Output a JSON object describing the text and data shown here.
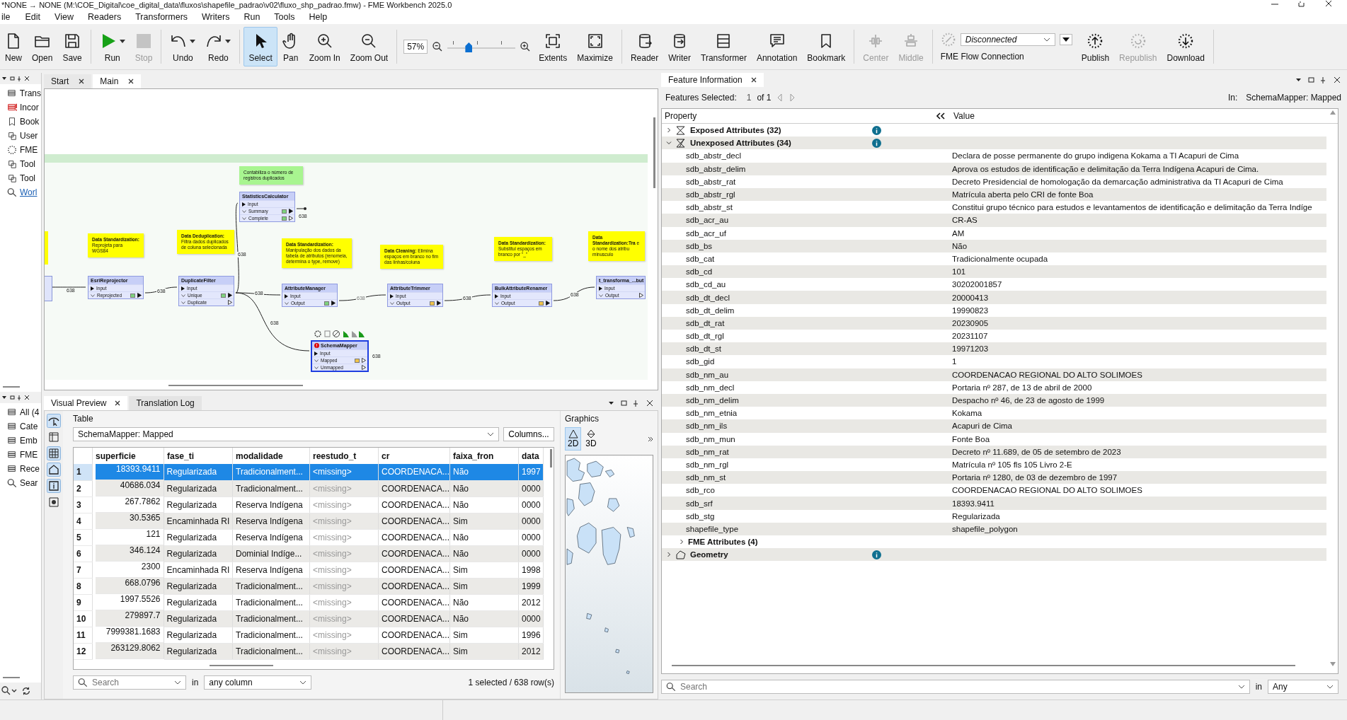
{
  "window": {
    "title": "*NONE → NONE (M:\\COE_Digital\\coe_digital_data\\fluxos\\shapefile_padrao\\v02\\fluxo_shp_padrao.fmw) - FME Workbench 2025.0"
  },
  "menu": [
    "ile",
    "Edit",
    "View",
    "Readers",
    "Transformers",
    "Writers",
    "Run",
    "Tools",
    "Help"
  ],
  "toolbar": [
    {
      "kind": "button",
      "label": "New",
      "disabled": false,
      "selected": false
    },
    {
      "kind": "button",
      "label": "Open",
      "disabled": false,
      "selected": false
    },
    {
      "kind": "button",
      "label": "Save",
      "disabled": false,
      "selected": false
    },
    {
      "kind": "split",
      "label": "Run",
      "disabled": false,
      "selected": false
    },
    {
      "kind": "button",
      "label": "Stop",
      "disabled": true,
      "selected": false
    },
    {
      "kind": "split",
      "label": "Undo",
      "disabled": false,
      "selected": false
    },
    {
      "kind": "split",
      "label": "Redo",
      "disabled": false,
      "selected": false
    },
    {
      "kind": "button",
      "label": "Select",
      "disabled": false,
      "selected": true
    },
    {
      "kind": "button",
      "label": "Pan",
      "disabled": false,
      "selected": false
    },
    {
      "kind": "button",
      "label": "Zoom In",
      "disabled": false,
      "selected": false
    },
    {
      "kind": "button",
      "label": "Zoom Out",
      "disabled": false,
      "selected": false
    },
    {
      "kind": "zoom",
      "value": "57%",
      "level": 0.3
    },
    {
      "kind": "button",
      "label": "Extents",
      "disabled": false,
      "selected": false
    },
    {
      "kind": "button",
      "label": "Maximize",
      "disabled": false,
      "selected": false
    },
    {
      "kind": "button",
      "label": "Reader",
      "disabled": false,
      "selected": false
    },
    {
      "kind": "button",
      "label": "Writer",
      "disabled": false,
      "selected": false
    },
    {
      "kind": "button",
      "label": "Transformer",
      "disabled": false,
      "selected": false
    },
    {
      "kind": "button",
      "label": "Annotation",
      "disabled": false,
      "selected": false
    },
    {
      "kind": "button",
      "label": "Bookmark",
      "disabled": false,
      "selected": false
    },
    {
      "kind": "button",
      "label": "Center",
      "disabled": true,
      "selected": false
    },
    {
      "kind": "button",
      "label": "Middle",
      "disabled": true,
      "selected": false
    },
    {
      "kind": "connection",
      "value": "Disconnected",
      "label": "FME Flow Connection"
    },
    {
      "kind": "button",
      "label": "Publish",
      "disabled": false,
      "selected": false
    },
    {
      "kind": "button",
      "label": "Republish",
      "disabled": true,
      "selected": false
    },
    {
      "kind": "button",
      "label": "Download",
      "disabled": false,
      "selected": false
    }
  ],
  "left_dock_top": [
    {
      "label": "Trans",
      "kind": "item"
    },
    {
      "label": "Incor",
      "kind": "item"
    },
    {
      "label": "Book",
      "kind": "item"
    },
    {
      "label": "User",
      "kind": "item"
    },
    {
      "label": "FME",
      "kind": "item"
    },
    {
      "label": "Tool",
      "kind": "item"
    },
    {
      "label": "Tool",
      "kind": "item"
    },
    {
      "label": "Worl",
      "kind": "link"
    }
  ],
  "left_dock_bottom": [
    {
      "label": "All (4"
    },
    {
      "label": "Cate"
    },
    {
      "label": "Emb"
    },
    {
      "label": "FME"
    },
    {
      "label": "Rece"
    },
    {
      "label": "Sear"
    }
  ],
  "canvas_tabs": [
    {
      "label": "Start",
      "selected": false
    },
    {
      "label": "Main",
      "selected": true
    }
  ],
  "workflow": {
    "annotations": [
      {
        "text": "Contabiliza o número de registros duplicados",
        "color": "#a8f590"
      },
      {
        "text": "**Data Standardization:** Reprojeta para WGS84",
        "color": "#ffff00"
      },
      {
        "text": "**Data Deduplication:** Filtra dados duplicados de coluna selecionada",
        "color": "#ffff00"
      },
      {
        "text": "**Data Standardization:** Manipulação dos dados da tabela de atributos (renomeia, determina o type, remove)",
        "color": "#ffff00"
      },
      {
        "text": "**Data Cleaning:** Elimina espaços em branco no fim das linhas/coluna",
        "color": "#ffff00"
      },
      {
        "text": "**Data Standardization:** Substitui espaços em branco por \"_\"",
        "color": "#ffff00"
      },
      {
        "text": "**Data Standardization:Tra** e o nome dos atribu minusculo",
        "color": "#ffff00"
      }
    ],
    "transformers": [
      {
        "name": "EsriReprojector",
        "selected": false,
        "error": false,
        "inputs": [
          "Input"
        ],
        "outputs": [
          {
            "name": "Reprojected",
            "color": "#7ed37e",
            "connected": true
          }
        ]
      },
      {
        "name": "DuplicateFilter",
        "selected": false,
        "error": false,
        "inputs": [
          "Input"
        ],
        "outputs": [
          {
            "name": "Unique",
            "color": "#7ed37e",
            "connected": true
          },
          {
            "name": "Duplicate",
            "connected": false
          }
        ]
      },
      {
        "name": "StatisticsCalculator",
        "selected": false,
        "error": false,
        "inputs": [
          "Input"
        ],
        "outputs": [
          {
            "name": "Summary",
            "color": "#7ed37e",
            "connected": true
          },
          {
            "name": "Complete",
            "color": "#7ed37e",
            "connected": false
          }
        ]
      },
      {
        "name": "AttributeManager",
        "selected": false,
        "error": false,
        "inputs": [
          "Input"
        ],
        "outputs": [
          {
            "name": "Output",
            "color": "#7ed37e",
            "connected": true
          }
        ]
      },
      {
        "name": "AttributeTrimmer",
        "selected": false,
        "error": false,
        "inputs": [
          "Input"
        ],
        "outputs": [
          {
            "name": "Output",
            "color": "#f0c44a",
            "connected": true
          }
        ]
      },
      {
        "name": "BulkAttributeRenamer",
        "selected": false,
        "error": false,
        "inputs": [
          "Input"
        ],
        "outputs": [
          {
            "name": "Output",
            "color": "#f0c44a",
            "connected": true
          }
        ]
      },
      {
        "name": "t_transforma_...but",
        "selected": false,
        "error": false,
        "inputs": [
          "Input"
        ],
        "outputs": [
          {
            "name": "Output",
            "connected": false
          }
        ]
      },
      {
        "name": "SchemaMapper",
        "selected": true,
        "error": true,
        "inputs": [
          "Input"
        ],
        "outputs": [
          {
            "name": "Mapped",
            "color": "#f0c44a",
            "connected": false
          },
          {
            "name": "Unmapped",
            "connected": false
          }
        ]
      }
    ],
    "edges": [
      {
        "label": "638",
        "dimmed": false
      },
      {
        "label": "638",
        "dimmed": false
      },
      {
        "label": "638",
        "dimmed": false
      },
      {
        "label": "638",
        "dimmed": false
      },
      {
        "label": "638",
        "dimmed": false
      },
      {
        "label": "638",
        "dimmed": true
      },
      {
        "label": "638",
        "dimmed": false
      },
      {
        "label": "638",
        "dimmed": false
      },
      {
        "label": "638",
        "dimmed": false
      },
      {
        "label": "638",
        "dimmed": false
      }
    ]
  },
  "visual_preview": {
    "tabs": [
      {
        "label": "Visual Preview",
        "selected": true
      },
      {
        "label": "Translation Log",
        "selected": false
      }
    ],
    "tools": [
      {
        "selected": true
      },
      {
        "selected": false
      },
      {
        "selected": true
      },
      {
        "selected": true
      },
      {
        "selected": true
      },
      {
        "selected": false
      }
    ],
    "table_label": "Table",
    "source": "SchemaMapper: Mapped",
    "columns_button": "Columns...",
    "columns": [
      {
        "label": "superficie",
        "muted": false
      },
      {
        "label": "fase_ti",
        "muted": false
      },
      {
        "label": "modalidade",
        "muted": false
      },
      {
        "label": "reestudo_t",
        "muted": true
      },
      {
        "label": "cr",
        "muted": false
      },
      {
        "label": "faixa_fron",
        "muted": false
      },
      {
        "label": "data",
        "muted": false
      }
    ],
    "rows": [
      {
        "index": "1",
        "selected": true,
        "cells": [
          "18393.9411",
          "Regularizada",
          "Tradicionalment...",
          "<missing>",
          "COORDENACA...",
          "Não",
          "1997"
        ]
      },
      {
        "index": "2",
        "selected": false,
        "cells": [
          "40686.034",
          "Regularizada",
          "Tradicionalment...",
          "<missing>",
          "COORDENACA...",
          "Não",
          "0000"
        ]
      },
      {
        "index": "3",
        "selected": false,
        "cells": [
          "267.7862",
          "Regularizada",
          "Reserva Indígena",
          "<missing>",
          "COORDENACA...",
          "Não",
          "0000"
        ]
      },
      {
        "index": "4",
        "selected": false,
        "cells": [
          "30.5365",
          "Encaminhada RI",
          "Reserva Indígena",
          "<missing>",
          "COORDENACA...",
          "Sim",
          "0000"
        ]
      },
      {
        "index": "5",
        "selected": false,
        "cells": [
          "121",
          "Regularizada",
          "Reserva Indígena",
          "<missing>",
          "COORDENACA...",
          "Não",
          "0000"
        ]
      },
      {
        "index": "6",
        "selected": false,
        "cells": [
          "346.124",
          "Regularizada",
          "Dominial Indíge...",
          "<missing>",
          "COORDENACA...",
          "Não",
          "0000"
        ]
      },
      {
        "index": "7",
        "selected": false,
        "cells": [
          "2300",
          "Encaminhada RI",
          "Reserva Indígena",
          "<missing>",
          "COORDENACA...",
          "Sim",
          "1998"
        ]
      },
      {
        "index": "8",
        "selected": false,
        "cells": [
          "668.0796",
          "Regularizada",
          "Tradicionalment...",
          "<missing>",
          "COORDENACA...",
          "Sim",
          "1999"
        ]
      },
      {
        "index": "9",
        "selected": false,
        "cells": [
          "1997.5526",
          "Regularizada",
          "Tradicionalment...",
          "<missing>",
          "COORDENACA...",
          "Não",
          "2012"
        ]
      },
      {
        "index": "10",
        "selected": false,
        "cells": [
          "279897.7",
          "Regularizada",
          "Tradicionalment...",
          "<missing>",
          "COORDENACA...",
          "Não",
          "0000"
        ]
      },
      {
        "index": "11",
        "selected": false,
        "cells": [
          "7999381.1683",
          "Regularizada",
          "Tradicionalment...",
          "<missing>",
          "COORDENACA...",
          "Sim",
          "1996"
        ]
      },
      {
        "index": "12",
        "selected": false,
        "cells": [
          "263129.8062",
          "Regularizada",
          "Tradicionalment...",
          "<missing>",
          "COORDENACA...",
          "Sim",
          "2012"
        ]
      }
    ],
    "search_placeholder": "Search",
    "in_label": "in",
    "scope": "any column",
    "count": "1 selected / 638 row(s)",
    "graphics": {
      "title": "Graphics",
      "modes": [
        {
          "label": "2D",
          "selected": true
        },
        {
          "label": "3D",
          "selected": false
        }
      ]
    }
  },
  "feature_info": {
    "tab": "Feature Information",
    "selected_label": "Features Selected:",
    "current": "1",
    "of": "of 1",
    "source_label": "In:",
    "source": "SchemaMapper: Mapped",
    "columns": [
      "Property",
      "Value"
    ],
    "tree": [
      {
        "label": "Exposed Attributes (32)",
        "kind": "sigma",
        "expanded": false,
        "info": true
      },
      {
        "label": "Unexposed Attributes (34)",
        "kind": "sigma-off",
        "expanded": true,
        "info": true,
        "children": [
          {
            "name": "sdb_abstr_decl",
            "value": "Declara de posse permanente do grupo indigena Kokama a TI Acapuri de Cima"
          },
          {
            "name": "sdb_abstr_delim",
            "value": "Aprova os estudos de identificação e delimitação da Terra Indígena Acapuri de Cima."
          },
          {
            "name": "sdb_abstr_rat",
            "value": "Decreto Presidencial de homologação da demarcação administrativa da TI Acapuri de Cima"
          },
          {
            "name": "sdb_abstr_rgl",
            "value": "Matrícula aberta pelo CRI de fonte Boa"
          },
          {
            "name": "sdb_abstr_st",
            "value": "Constitui grupo técnico para estudos e levantamentos de identificação e delimitação da Terra Indíge"
          },
          {
            "name": "sdb_acr_au",
            "value": "CR-AS"
          },
          {
            "name": "sdb_acr_uf",
            "value": "AM"
          },
          {
            "name": "sdb_bs",
            "value": "Não"
          },
          {
            "name": "sdb_cat",
            "value": "Tradicionalmente ocupada"
          },
          {
            "name": "sdb_cd",
            "value": "101"
          },
          {
            "name": "sdb_cd_au",
            "value": "30202001857"
          },
          {
            "name": "sdb_dt_decl",
            "value": "20000413"
          },
          {
            "name": "sdb_dt_delim",
            "value": "19990823"
          },
          {
            "name": "sdb_dt_rat",
            "value": "20230905"
          },
          {
            "name": "sdb_dt_rgl",
            "value": "20231107"
          },
          {
            "name": "sdb_dt_st",
            "value": "19971203"
          },
          {
            "name": "sdb_gid",
            "value": "1"
          },
          {
            "name": "sdb_nm_au",
            "value": "COORDENACAO REGIONAL DO ALTO SOLIMOES"
          },
          {
            "name": "sdb_nm_decl",
            "value": "Portaria nº 287, de 13 de abril de 2000"
          },
          {
            "name": "sdb_nm_delim",
            "value": "Despacho nº 46, de 23 de agosto de 1999"
          },
          {
            "name": "sdb_nm_etnia",
            "value": "Kokama"
          },
          {
            "name": "sdb_nm_ils",
            "value": "Acapuri de Cima"
          },
          {
            "name": "sdb_nm_mun",
            "value": "Fonte Boa"
          },
          {
            "name": "sdb_nm_rat",
            "value": "Decreto nº 11.689, de 05 de setembro de 2023"
          },
          {
            "name": "sdb_nm_rgl",
            "value": "Matrícula nº 105 fls 105 Livro 2-E"
          },
          {
            "name": "sdb_nm_st",
            "value": "Portaria nº 1280, de 03 de dezembro de 1997"
          },
          {
            "name": "sdb_rco",
            "value": "COORDENACAO REGIONAL DO ALTO SOLIMOES"
          },
          {
            "name": "sdb_srf",
            "value": "18393.9411"
          },
          {
            "name": "sdb_stg",
            "value": "Regularizada"
          },
          {
            "name": "shapefile_type",
            "value": "shapefile_polygon"
          },
          {
            "label": "FME Attributes (4)",
            "expanded": false,
            "info": false
          }
        ]
      },
      {
        "label": "Geometry",
        "kind": "geometry",
        "expanded": false,
        "info": true
      }
    ],
    "search_placeholder": "Search",
    "in_label": "in",
    "scope": "Any"
  }
}
